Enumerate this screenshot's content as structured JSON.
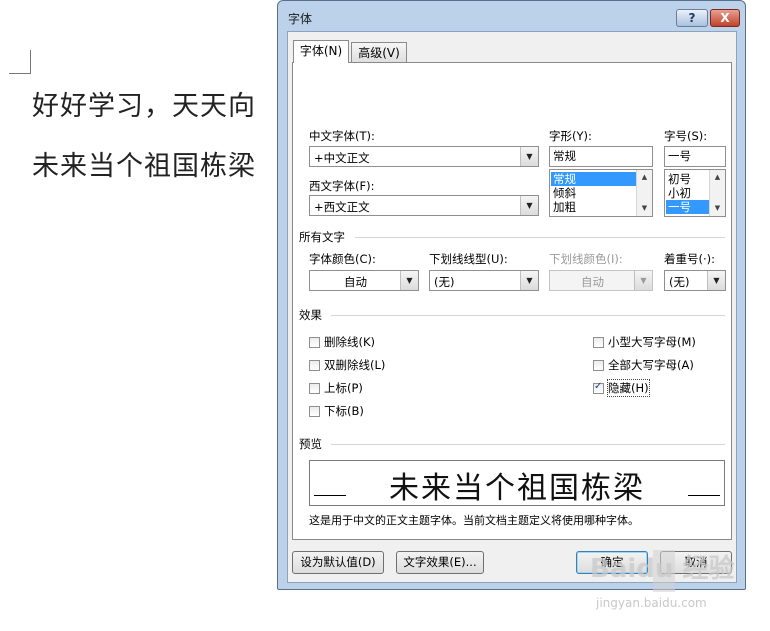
{
  "document": {
    "line1": "好好学习，天天向",
    "line2": "未来当个祖国栋梁"
  },
  "dialog": {
    "title": "字体",
    "help_label": "?",
    "close_label": "X",
    "tabs": [
      {
        "label": "字体(N)",
        "active": true
      },
      {
        "label": "高级(V)",
        "active": false
      }
    ],
    "chinese_font": {
      "label": "中文字体(T):",
      "value": "+中文正文"
    },
    "western_font": {
      "label": "西文字体(F):",
      "value": "+西文正文"
    },
    "font_style": {
      "label": "字形(Y):",
      "value": "常规",
      "options": [
        "常规",
        "倾斜",
        "加粗"
      ],
      "selected": "常规"
    },
    "font_size": {
      "label": "字号(S):",
      "value": "一号",
      "options": [
        "初号",
        "小初",
        "一号"
      ],
      "selected": "一号"
    },
    "all_text": {
      "section_label": "所有文字",
      "font_color": {
        "label": "字体颜色(C):",
        "value": "自动"
      },
      "underline_style": {
        "label": "下划线线型(U):",
        "value": "(无)"
      },
      "underline_color": {
        "label": "下划线颜色(I):",
        "value": "自动",
        "disabled": true
      },
      "emphasis": {
        "label": "着重号(·):",
        "value": "(无)"
      }
    },
    "effects": {
      "section_label": "效果",
      "left": [
        {
          "label": "删除线(K)",
          "checked": false
        },
        {
          "label": "双删除线(L)",
          "checked": false
        },
        {
          "label": "上标(P)",
          "checked": false
        },
        {
          "label": "下标(B)",
          "checked": false
        }
      ],
      "right": [
        {
          "label": "小型大写字母(M)",
          "checked": false
        },
        {
          "label": "全部大写字母(A)",
          "checked": false
        },
        {
          "label": "隐藏(H)",
          "checked": true
        }
      ]
    },
    "preview": {
      "section_label": "预览",
      "sample_text": "未来当个祖国栋梁",
      "description": "这是用于中文的正文主题字体。当前文档主题定义将使用哪种字体。"
    },
    "buttons": {
      "set_default": "设为默认值(D)",
      "text_effects": "文字效果(E)...",
      "ok": "确定",
      "cancel": "取消"
    }
  },
  "watermark": {
    "brand": "Baidu 经验",
    "url": "jingyan.baidu.com"
  }
}
